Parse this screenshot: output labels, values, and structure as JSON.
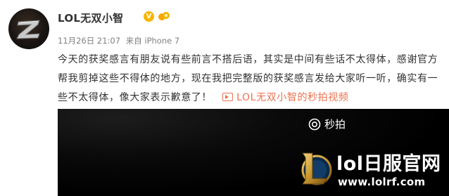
{
  "post": {
    "username": "LOL无双小智",
    "vip_badge": "V",
    "meta": {
      "date": "11月26日 21:07",
      "source_prefix": "来自",
      "source": "iPhone 7"
    },
    "text": "今天的获奖感言有朋友说有些前言不搭后语，其实是中间有些话不太得体，感谢官方帮我剪掉这些不得体的地方，现在我把完整版的获奖感言发给大家听一听，确实有一些不太得体，像大家表示歉意了！",
    "video_link": "LOL无双小智的秒拍视频"
  },
  "video": {
    "brand": "秒拍"
  },
  "watermark": {
    "title": "lol日服官网",
    "url": "www.lolrf.com"
  },
  "colors": {
    "username": "#333333",
    "meta": "#808080",
    "link": "#eb7350",
    "vip": "#f7b500",
    "video_bg": "#000000"
  }
}
